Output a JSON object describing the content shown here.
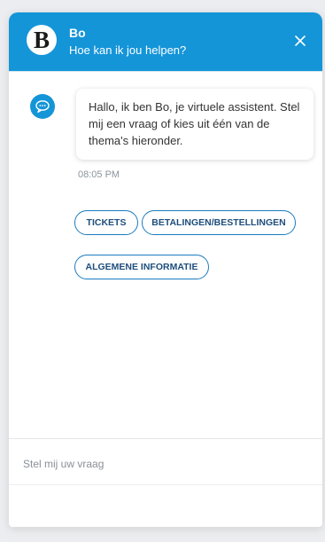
{
  "header": {
    "logo_letter": "B",
    "bot_name": "Bo",
    "subtitle": "Hoe kan ik jou helpen?",
    "close_icon": "close-icon",
    "background_color": "#1495d8"
  },
  "conversation": {
    "messages": [
      {
        "sender_icon": "chat-bubble-icon",
        "text": "Hallo, ik ben Bo, je virtuele assistent. Stel mij een vraag of kies uit één van de thema's hieronder.",
        "time": "08:05 PM"
      }
    ],
    "quick_replies": [
      {
        "label": "TICKETS"
      },
      {
        "label": "BETALINGEN/BESTELLINGEN"
      },
      {
        "label": "ALGEMENE INFORMATIE"
      }
    ]
  },
  "composer": {
    "placeholder": "Stel mij uw vraag",
    "value": ""
  }
}
